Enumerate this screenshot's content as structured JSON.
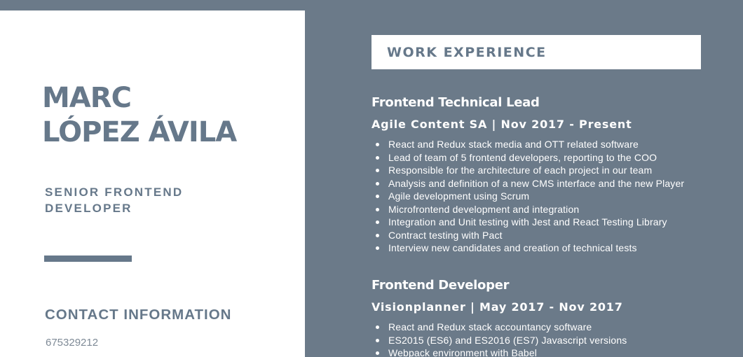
{
  "profile": {
    "name_line1": "MARC",
    "name_line2": "LÓPEZ ÁVILA",
    "title_line1": "SENIOR FRONTEND",
    "title_line2": "DEVELOPER",
    "contact_heading": "CONTACT INFORMATION",
    "phone": "675329212"
  },
  "experience": {
    "heading": "WORK EXPERIENCE",
    "jobs": [
      {
        "role": "Frontend Technical Lead",
        "company": "Agile Content SA | Nov 2017 - Present",
        "bullets": [
          "React and Redux stack media and OTT related software",
          "Lead of team of 5 frontend developers, reporting to the COO",
          "Responsible for the architecture of each project in our team",
          "Analysis and definition of a new CMS interface and the new Player",
          "Agile development using Scrum",
          "Microfrontend development and integration",
          "Integration and Unit testing with Jest and React Testing Library",
          "Contract testing with Pact",
          "Interview new candidates and creation of technical tests"
        ]
      },
      {
        "role": "Frontend Developer",
        "company": "Visionplanner | May 2017 - Nov 2017",
        "bullets": [
          "React and Redux stack accountancy software",
          "ES2015 (ES6) and ES2016 (ES7) Javascript versions",
          "Webpack environment with Babel"
        ]
      }
    ]
  },
  "colors": {
    "background": "#6b7a89",
    "panel": "#ffffff",
    "accent": "#66788a"
  }
}
